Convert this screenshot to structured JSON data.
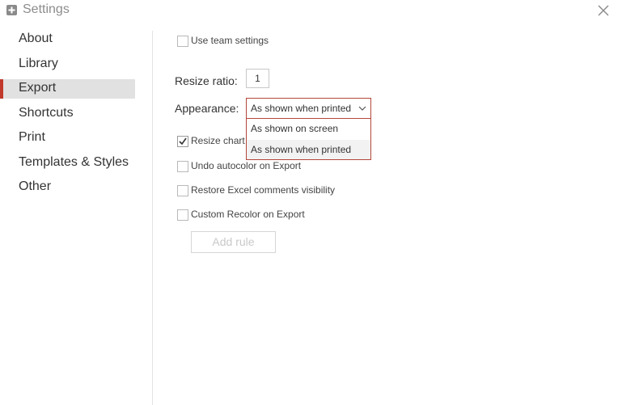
{
  "window": {
    "title": "Settings"
  },
  "icons": {
    "app": "plus-square-icon",
    "close": "close-icon",
    "chevron": "chevron-down-icon",
    "check": "checkmark-icon"
  },
  "colors": {
    "accent": "#c0392b",
    "active_bg": "#e1e1e1",
    "dropdown_border": "#b3473a"
  },
  "sidebar": {
    "items": [
      {
        "label": "About",
        "active": false
      },
      {
        "label": "Library",
        "active": false
      },
      {
        "label": "Export",
        "active": true
      },
      {
        "label": "Shortcuts",
        "active": false
      },
      {
        "label": "Print",
        "active": false
      },
      {
        "label": "Templates & Styles",
        "active": false
      },
      {
        "label": "Other",
        "active": false
      }
    ]
  },
  "export": {
    "use_team_settings": {
      "label": "Use team settings",
      "checked": false
    },
    "resize_ratio": {
      "label": "Resize ratio:",
      "value": "1"
    },
    "appearance": {
      "label": "Appearance:",
      "selected": "As shown when printed",
      "options": [
        "As shown on screen",
        "As shown when printed"
      ]
    },
    "resize_chart": {
      "label": "Resize chart l",
      "checked": true
    },
    "undo_autocolor": {
      "label": "Undo autocolor on Export",
      "checked": false
    },
    "restore_comments": {
      "label": "Restore Excel comments visibility",
      "checked": false
    },
    "custom_recolor": {
      "label": "Custom Recolor on Export",
      "checked": false
    },
    "add_rule": {
      "label": "Add rule",
      "enabled": false
    }
  }
}
